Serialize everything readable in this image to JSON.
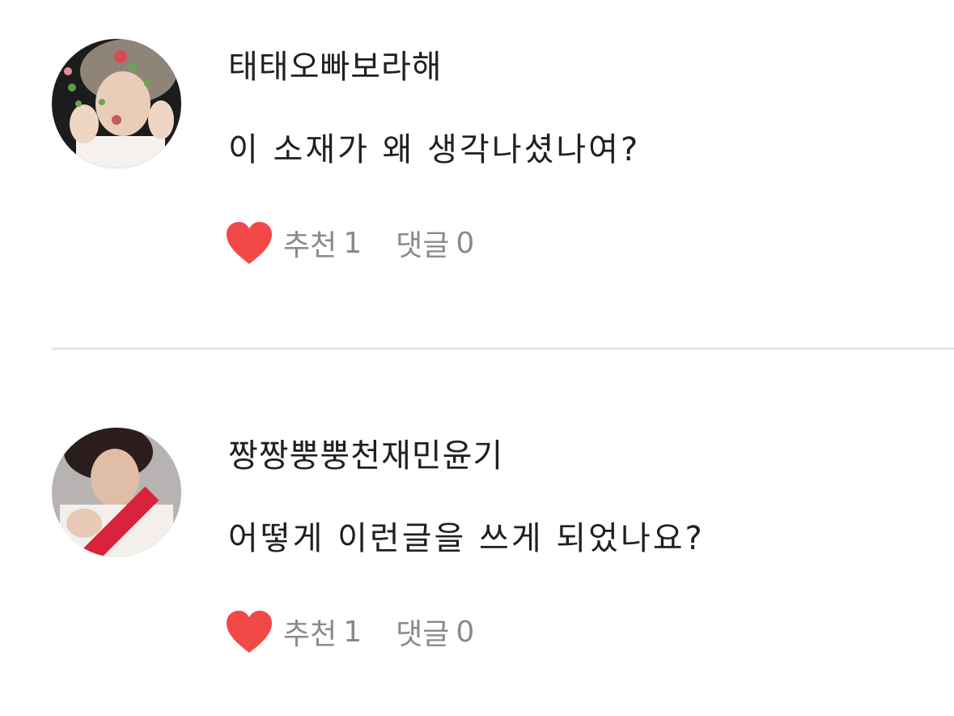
{
  "comments": [
    {
      "username": "태태오빠보라해",
      "text": "이 소재가 왜 생각나셨나여?",
      "like_label": "추천",
      "like_count": "1",
      "reply_label": "댓글",
      "reply_count": "0"
    },
    {
      "username": "짱짱뿡뿡천재민윤기",
      "text": "어떻게 이런글을 쓰게 되었나요?",
      "like_label": "추천",
      "like_count": "1",
      "reply_label": "댓글",
      "reply_count": "0"
    }
  ],
  "icons": {
    "like": "heart-icon"
  },
  "colors": {
    "heart": "#f34848",
    "meta_text": "#8a8a8a",
    "body_text": "#202020",
    "divider": "#e6e6e6"
  }
}
